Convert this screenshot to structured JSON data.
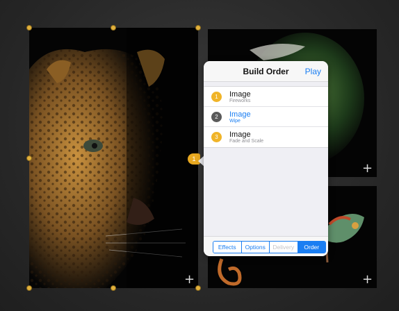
{
  "build_marker": {
    "number": "1",
    "color": "#e8a820"
  },
  "popover": {
    "title": "Build Order",
    "play_label": "Play",
    "builds": [
      {
        "number": "1",
        "name": "Image",
        "effect": "Fireworks",
        "badge_color": "#f0b428",
        "active": false
      },
      {
        "number": "2",
        "name": "Image",
        "effect": "Wipe",
        "badge_color": "#5a5a5a",
        "active": true
      },
      {
        "number": "3",
        "name": "Image",
        "effect": "Fade and Scale",
        "badge_color": "#f0b428",
        "active": false
      }
    ],
    "tabs": [
      {
        "label": "Effects",
        "state": "normal"
      },
      {
        "label": "Options",
        "state": "normal"
      },
      {
        "label": "Delivery",
        "state": "disabled"
      },
      {
        "label": "Order",
        "state": "selected"
      }
    ]
  },
  "add_glyph": "+",
  "colors": {
    "accent": "#1a7ef2",
    "selection_handle": "#e2b13c"
  }
}
